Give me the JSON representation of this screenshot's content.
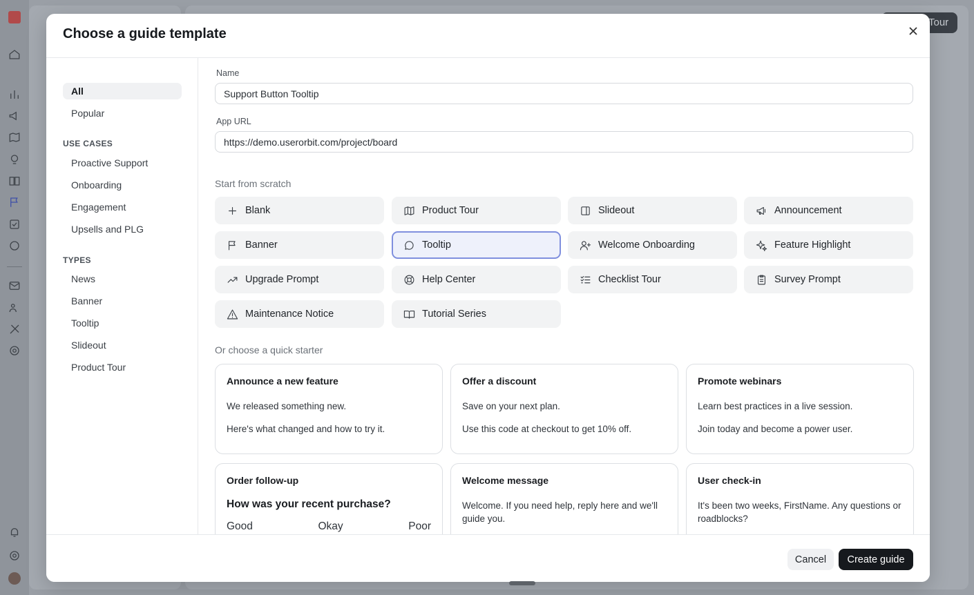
{
  "background": {
    "tour_button_label": "Tour",
    "rail_icons": [
      "home-icon",
      "chart-icon",
      "megaphone-icon",
      "map-icon",
      "lightbulb-icon",
      "book-icon",
      "flag-icon",
      "checklist-icon",
      "chat-icon",
      "mail-icon",
      "users-icon",
      "tools-icon",
      "gear-icon",
      "bell-icon",
      "help-icon"
    ]
  },
  "modal": {
    "title": "Choose a guide template",
    "close_icon": "close-icon"
  },
  "sidebar": {
    "top_items": [
      {
        "label": "All",
        "active": true
      },
      {
        "label": "Popular",
        "active": false
      }
    ],
    "use_cases_heading": "USE CASES",
    "use_cases": [
      "Proactive Support",
      "Onboarding",
      "Engagement",
      "Upsells and PLG"
    ],
    "types_heading": "TYPES",
    "types": [
      "News",
      "Banner",
      "Tooltip",
      "Slideout",
      "Product Tour"
    ]
  },
  "form": {
    "name_label": "Name",
    "name_value": "Support Button Tooltip",
    "url_label": "App URL",
    "url_value": "https://demo.userorbit.com/project/board"
  },
  "scratch": {
    "heading": "Start from scratch",
    "templates": [
      {
        "label": "Blank",
        "icon": "plus-icon"
      },
      {
        "label": "Product Tour",
        "icon": "map-icon"
      },
      {
        "label": "Slideout",
        "icon": "panel-icon"
      },
      {
        "label": "Announcement",
        "icon": "megaphone-icon"
      },
      {
        "label": "Banner",
        "icon": "flag-icon"
      },
      {
        "label": "Tooltip",
        "icon": "speech-bubble-icon",
        "selected": true
      },
      {
        "label": "Welcome Onboarding",
        "icon": "user-plus-icon"
      },
      {
        "label": "Feature Highlight",
        "icon": "sparkles-icon"
      },
      {
        "label": "Upgrade Prompt",
        "icon": "trending-up-icon"
      },
      {
        "label": "Help Center",
        "icon": "lifebuoy-icon"
      },
      {
        "label": "Checklist Tour",
        "icon": "checklist-icon"
      },
      {
        "label": "Survey Prompt",
        "icon": "clipboard-icon"
      },
      {
        "label": "Maintenance Notice",
        "icon": "warning-icon"
      },
      {
        "label": "Tutorial Series",
        "icon": "book-open-icon"
      }
    ]
  },
  "starters": {
    "heading": "Or choose a quick starter",
    "cards": [
      {
        "title": "Announce a new feature",
        "line1": "We released something new.",
        "line2": "Here's what changed and how to try it."
      },
      {
        "title": "Offer a discount",
        "line1": "Save on your next plan.",
        "line2": "Use this code at checkout to get 10% off."
      },
      {
        "title": "Promote webinars",
        "line1": "Learn best practices in a live session.",
        "line2": "Join today and become a power user."
      },
      {
        "title": "Order follow-up",
        "question": "How was your recent purchase?",
        "options": [
          "Good",
          "Okay",
          "Poor"
        ]
      },
      {
        "title": "Welcome message",
        "line1": "Welcome. If you need help, reply here and we'll guide you."
      },
      {
        "title": "User check-in",
        "line1": "It's been two weeks, FirstName. Any questions or roadblocks?"
      }
    ]
  },
  "footer": {
    "cancel_label": "Cancel",
    "create_label": "Create guide"
  }
}
